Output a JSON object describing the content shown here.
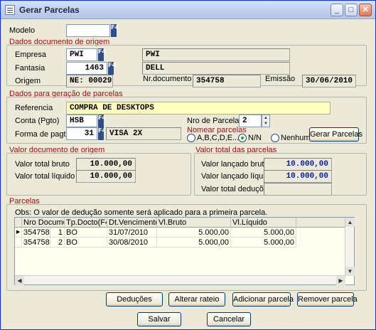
{
  "window": {
    "title": "Gerar Parcelas",
    "min": "_",
    "max": "□",
    "close": "✕"
  },
  "modelo": {
    "label": "Modelo",
    "value": ""
  },
  "f4": "F4",
  "origem_doc": {
    "title": "Dados documento de origem",
    "empresa_label": "Empresa",
    "empresa_code": "PWI",
    "empresa_name": "PWI",
    "fantasia_label": "Fantasia",
    "fantasia_code": "1463",
    "fantasia_name": "DELL",
    "origem_label": "Origem",
    "origem_value": "NE: 000298",
    "nrdoc_label": "Nr.documento",
    "nrdoc_value": "354758",
    "emissao_label": "Emissão",
    "emissao_value": "30/06/2010"
  },
  "geracao": {
    "title": "Dados para geração de parcelas",
    "referencia_label": "Referencia",
    "referencia_value": "COMPRA DE DESKTOPS",
    "conta_label": "Conta (Pgto)",
    "conta_value": "HSB",
    "nro_parcelas_label": "Nro de Parcelas",
    "nro_parcelas_value": "2",
    "forma_label": "Forma de pagto",
    "forma_code": "31",
    "forma_desc": "VISA 2X",
    "nomear_label": "Nomear parcelas",
    "opt_abc": "A,B,C,D,E...",
    "opt_nn": "N/N",
    "opt_nenhum": "Nenhum",
    "gerar_button": "Gerar Parcelas"
  },
  "valor_origem": {
    "title": "Valor documento de origem",
    "bruto_label": "Valor total bruto",
    "bruto_value": "10.000,00",
    "liquido_label": "Valor total líquido",
    "liquido_value": "10.000,00"
  },
  "valor_parcelas": {
    "title": "Valor total das parcelas",
    "bruto_label": "Valor lançado bruto",
    "bruto_value": "10.000,00",
    "liquido_label": "Valor lançado líquido",
    "liquido_value": "10.000,00",
    "deducoes_label": "Valor total deduções",
    "deducoes_value": ""
  },
  "parcelas": {
    "title": "Parcelas",
    "obs": "Obs: O valor de dedução somente será aplicado para a primeira parcela.",
    "columns": [
      "Nro Document",
      "Tp.Docto(F4)",
      "Dt.Vencimento",
      "Vl.Bruto",
      "Vl.Líquido"
    ],
    "rows": [
      {
        "doc": "354758",
        "n": "1",
        "tp": "BO",
        "dt": "31/07/2010",
        "bruto": "5.000,00",
        "liquido": "5.000,00"
      },
      {
        "doc": "354758",
        "n": "2",
        "tp": "BO",
        "dt": "30/08/2010",
        "bruto": "5.000,00",
        "liquido": "5.000,00"
      }
    ]
  },
  "actions": {
    "deducoes": "Deduções",
    "alterar": "Alterar rateio",
    "adicionar": "Adicionar parcela",
    "remover": "Remover parcela",
    "salvar": "Salvar",
    "cancelar": "Cancelar"
  }
}
